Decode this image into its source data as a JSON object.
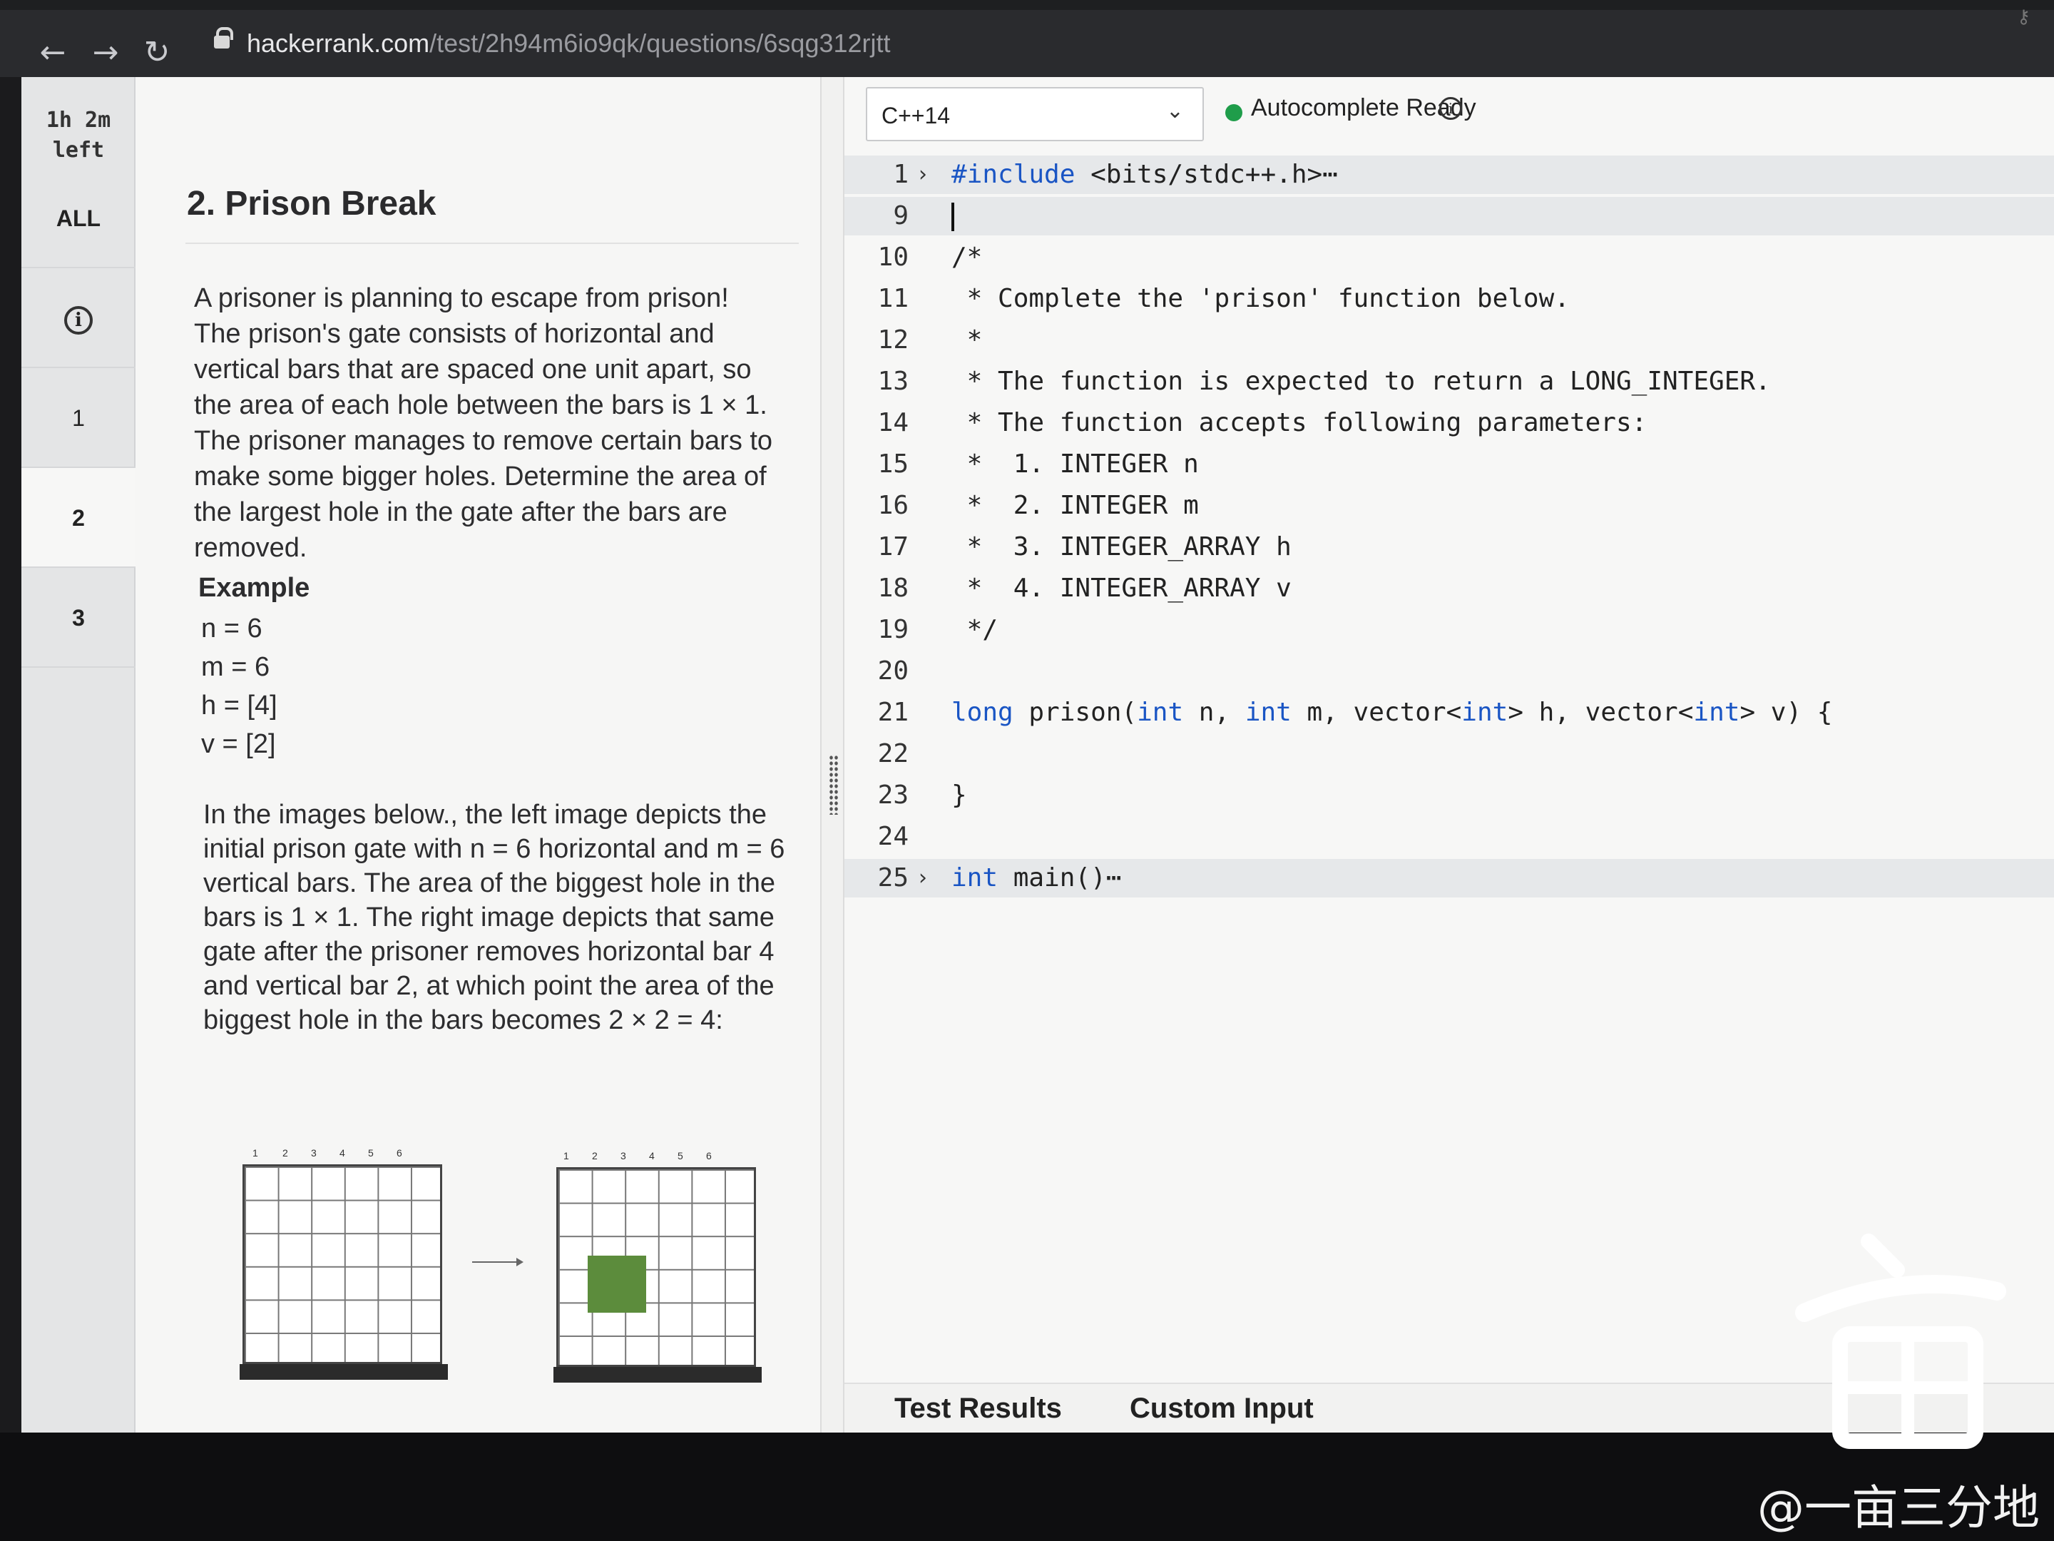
{
  "browser": {
    "url_host": "hackerrank.com",
    "url_path": "/test/2h94m6io9qk/questions/6sqg312rjtt",
    "back_icon": "←",
    "forward_icon": "→",
    "reload_icon": "↻"
  },
  "sidebar": {
    "timer_line1": "1h 2m",
    "timer_line2": "left",
    "items": [
      {
        "label": "ALL"
      },
      {
        "label": "i"
      },
      {
        "label": "1"
      },
      {
        "label": "2"
      },
      {
        "label": "3"
      }
    ]
  },
  "problem": {
    "title": "2. Prison Break",
    "description": "A prisoner is planning to escape from prison! The prison's gate consists of horizontal and vertical bars that are spaced one unit apart, so the area of each hole between the bars is 1 × 1. The prisoner manages to remove certain bars to make some bigger holes. Determine the area of the largest hole in the gate after the bars are removed.",
    "example_heading": "Example",
    "example_lines": [
      "n = 6",
      "m = 6",
      "h = [4]",
      "v = [2]"
    ],
    "explanation": "In the images below., the left image depicts the initial prison gate with n = 6 horizontal and m = 6 vertical bars. The area of the biggest hole in the bars is 1 × 1. The right image depicts that same gate after the prisoner removes horizontal bar 4 and vertical bar 2, at which point the area of the biggest hole in the bars becomes 2 × 2 = 4:",
    "figure_ticks": [
      "1",
      "2",
      "3",
      "4",
      "5",
      "6"
    ]
  },
  "editor": {
    "language": "C++14",
    "autocomplete_status": "Autocomplete Ready",
    "status_color": "#1f9d4a",
    "lines": [
      {
        "n": "1",
        "fold": "›",
        "text": "#include <bits/stdc++.h>⋯"
      },
      {
        "n": "9",
        "fold": "",
        "text": ""
      },
      {
        "n": "10",
        "fold": "",
        "text": "/*"
      },
      {
        "n": "11",
        "fold": "",
        "text": " * Complete the 'prison' function below."
      },
      {
        "n": "12",
        "fold": "",
        "text": " *"
      },
      {
        "n": "13",
        "fold": "",
        "text": " * The function is expected to return a LONG_INTEGER."
      },
      {
        "n": "14",
        "fold": "",
        "text": " * The function accepts following parameters:"
      },
      {
        "n": "15",
        "fold": "",
        "text": " *  1. INTEGER n"
      },
      {
        "n": "16",
        "fold": "",
        "text": " *  2. INTEGER m"
      },
      {
        "n": "17",
        "fold": "",
        "text": " *  3. INTEGER_ARRAY h"
      },
      {
        "n": "18",
        "fold": "",
        "text": " *  4. INTEGER_ARRAY v"
      },
      {
        "n": "19",
        "fold": "",
        "text": " */"
      },
      {
        "n": "20",
        "fold": "",
        "text": ""
      },
      {
        "n": "21",
        "fold": "",
        "text": "long prison(int n, int m, vector<int> h, vector<int> v) {"
      },
      {
        "n": "22",
        "fold": "",
        "text": ""
      },
      {
        "n": "23",
        "fold": "",
        "text": "}"
      },
      {
        "n": "24",
        "fold": "",
        "text": ""
      },
      {
        "n": "25",
        "fold": "›",
        "text": "int main()⋯"
      }
    ],
    "tabs": [
      "Test Results",
      "Custom Input"
    ]
  },
  "watermark": "@一亩三分地"
}
